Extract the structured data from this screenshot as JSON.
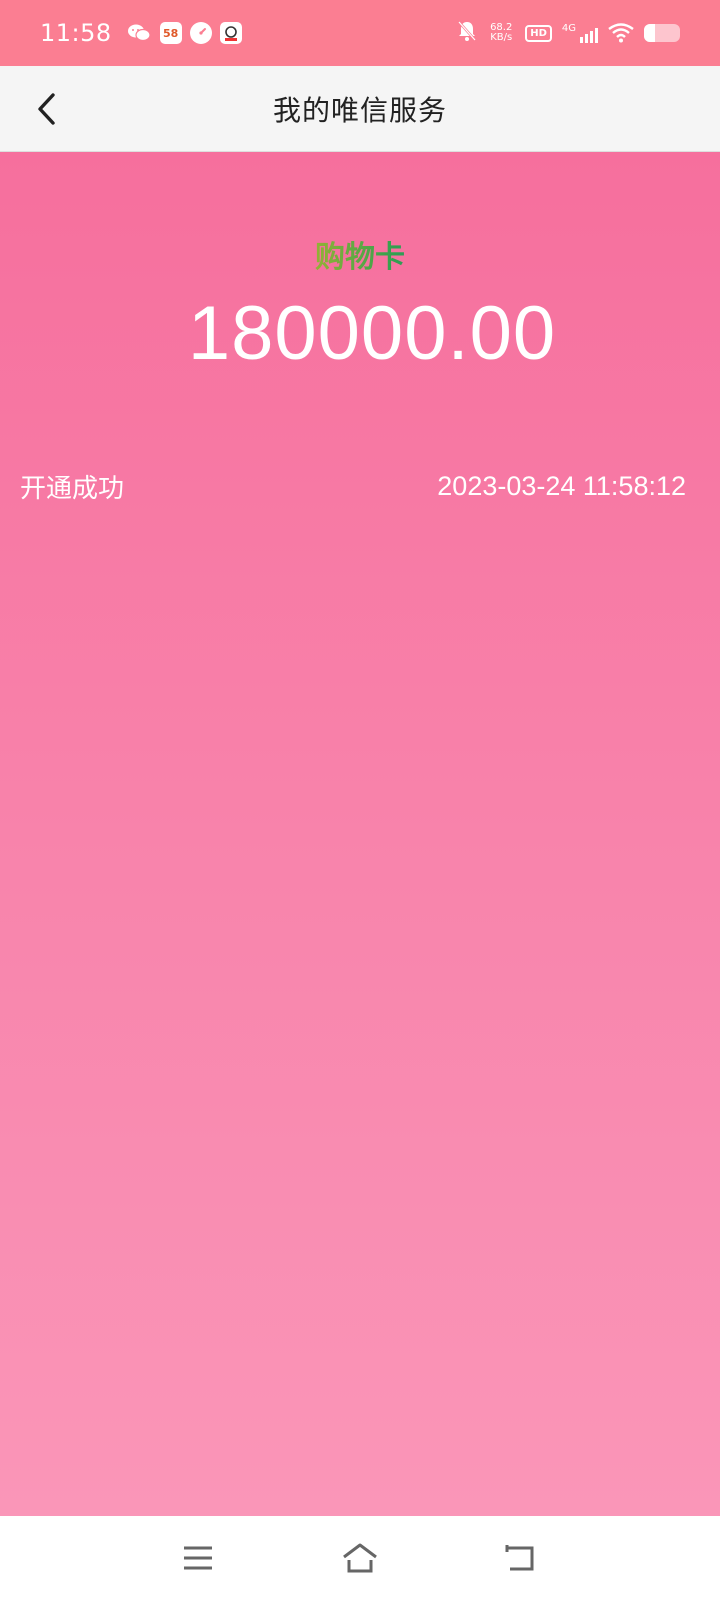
{
  "status_bar": {
    "time": "11:58",
    "notification_icons": [
      "wechat-icon",
      "app-58-icon",
      "speedometer-icon",
      "shopping-app-icon"
    ],
    "app58_label": "58",
    "net_speed_value": "68.2",
    "net_speed_unit": "KB/s",
    "hd_label": "HD",
    "network_type": "4G",
    "battery_level": 0.3
  },
  "header": {
    "title": "我的唯信服务"
  },
  "card": {
    "label": "购物卡",
    "amount": "180000.00"
  },
  "status": {
    "text": "开通成功",
    "datetime": "2023-03-24 11:58:12"
  },
  "colors": {
    "status_bar": "#fb7e92",
    "header_bg": "#f5f5f5",
    "main_top": "#f66f9d",
    "main_bottom": "#fa96b8",
    "nav_bg": "#ffffff"
  },
  "nav": {
    "buttons": [
      "menu-icon",
      "home-icon",
      "back-nav-icon"
    ]
  }
}
